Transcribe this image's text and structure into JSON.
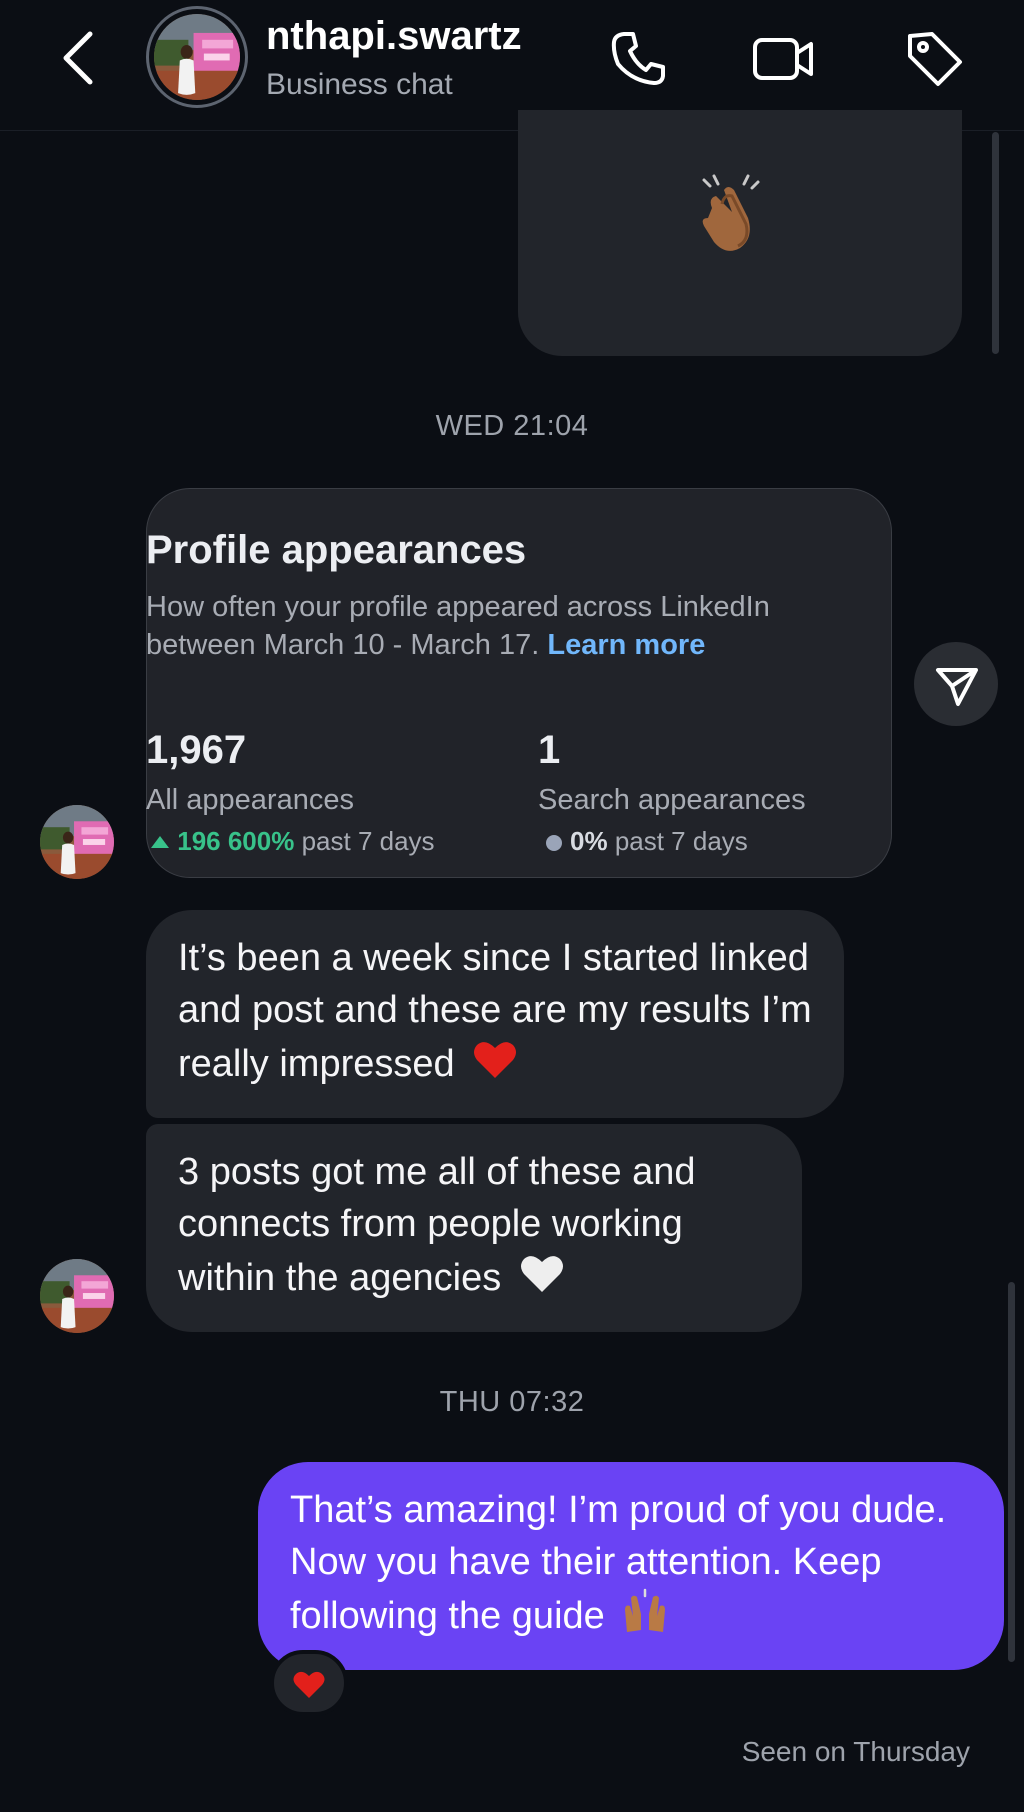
{
  "header": {
    "username": "nthapi.swartz",
    "subtitle": "Business chat",
    "icons": [
      "back-chevron-icon",
      "phone-icon",
      "video-camera-icon",
      "tag-icon"
    ]
  },
  "thread": {
    "timestamp_1": "WED 21:04",
    "timestamp_2": "THU 07:32",
    "card": {
      "title": "Profile appearances",
      "description": "How often your profile appeared across LinkedIn between March 10 - March 17.",
      "link": "Learn more",
      "stats": [
        {
          "value": "1,967",
          "label": "All appearances",
          "change": "196 600%",
          "period": "past 7 days"
        },
        {
          "value": "1",
          "label": "Search appearances",
          "change": "0%",
          "period": "past 7 days"
        }
      ]
    },
    "messages": {
      "incoming_1": "It’s been a week since I started linked and post and these are my results I’m really impressed",
      "incoming_2": "3 posts got me all of these and connects from people working within the agencies",
      "outgoing_1": "That’s amazing! I’m proud of you dude. Now you have their attention. Keep following the guide"
    },
    "seen": "Seen on Thursday"
  },
  "colors": {
    "background": "#0b0e14",
    "incoming_bubble": "#22252b",
    "outgoing_bubble": "#6a43f4",
    "link": "#71b7fb",
    "positive": "#38c28a"
  }
}
